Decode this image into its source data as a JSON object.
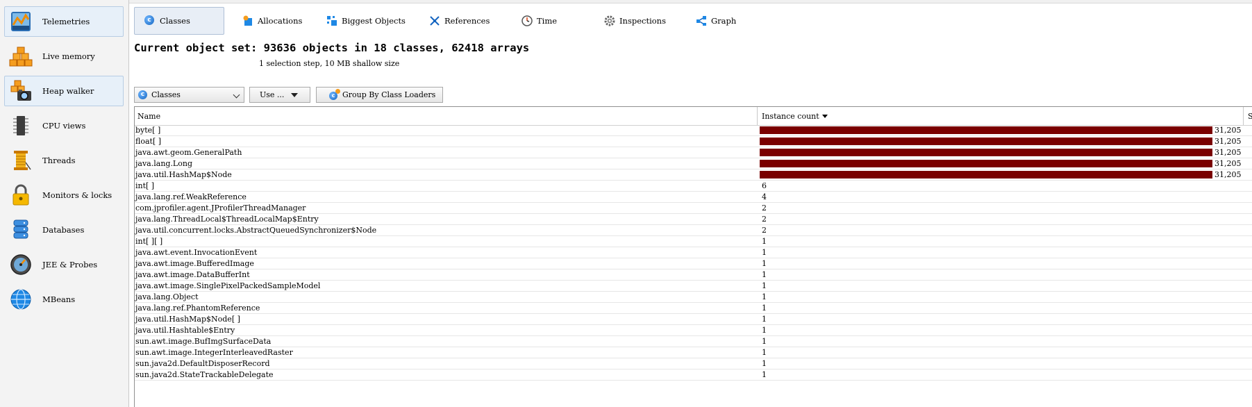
{
  "sidebar": {
    "items": [
      {
        "label": "Telemetries",
        "icon": "telemetries-icon",
        "selected": true
      },
      {
        "label": "Live memory",
        "icon": "live-memory-icon",
        "selected": false
      },
      {
        "label": "Heap walker",
        "icon": "heap-walker-icon",
        "selected": true
      },
      {
        "label": "CPU views",
        "icon": "cpu-views-icon",
        "selected": false
      },
      {
        "label": "Threads",
        "icon": "threads-icon",
        "selected": false
      },
      {
        "label": "Monitors & locks",
        "icon": "lock-icon",
        "selected": false
      },
      {
        "label": "Databases",
        "icon": "database-icon",
        "selected": false
      },
      {
        "label": "JEE & Probes",
        "icon": "gauge-icon",
        "selected": false
      },
      {
        "label": "MBeans",
        "icon": "globe-icon",
        "selected": false
      }
    ]
  },
  "tabs": [
    {
      "label": "Classes",
      "icon": "class-icon",
      "selected": true
    },
    {
      "label": "Allocations",
      "icon": "allocations-icon",
      "selected": false
    },
    {
      "label": "Biggest Objects",
      "icon": "biggest-objects-icon",
      "selected": false
    },
    {
      "label": "References",
      "icon": "references-icon",
      "selected": false
    },
    {
      "label": "Time",
      "icon": "clock-icon",
      "selected": false
    },
    {
      "label": "Inspections",
      "icon": "gear-icon",
      "selected": false
    },
    {
      "label": "Graph",
      "icon": "graph-icon",
      "selected": false
    }
  ],
  "header": {
    "title": "Current object set: 93636 objects in 18 classes, 62418 arrays",
    "subtitle": "1 selection step, 10 MB shallow size"
  },
  "toolbar": {
    "view_select": "Classes",
    "use_label": "Use ...",
    "group_button": "Group By Class Loaders"
  },
  "table": {
    "columns": [
      "Name",
      "Instance count",
      "S"
    ],
    "sort_column": "Instance count",
    "sort_direction": "descending",
    "bar_color": "#7a0000",
    "rows": [
      {
        "name": "byte[ ]",
        "count": "31,205",
        "bar": 1.0
      },
      {
        "name": "float[ ]",
        "count": "31,205",
        "bar": 1.0
      },
      {
        "name": "java.awt.geom.GeneralPath",
        "count": "31,205",
        "bar": 1.0
      },
      {
        "name": "java.lang.Long",
        "count": "31,205",
        "bar": 1.0
      },
      {
        "name": "java.util.HashMap$Node",
        "count": "31,205",
        "bar": 1.0
      },
      {
        "name": "int[ ]",
        "count": "6",
        "bar": 0
      },
      {
        "name": "java.lang.ref.WeakReference",
        "count": "4",
        "bar": 0
      },
      {
        "name": "com.jprofiler.agent.JProfilerThreadManager",
        "count": "2",
        "bar": 0
      },
      {
        "name": "java.lang.ThreadLocal$ThreadLocalMap$Entry",
        "count": "2",
        "bar": 0
      },
      {
        "name": "java.util.concurrent.locks.AbstractQueuedSynchronizer$Node",
        "count": "2",
        "bar": 0
      },
      {
        "name": "int[ ][ ]",
        "count": "1",
        "bar": 0
      },
      {
        "name": "java.awt.event.InvocationEvent",
        "count": "1",
        "bar": 0
      },
      {
        "name": "java.awt.image.BufferedImage",
        "count": "1",
        "bar": 0
      },
      {
        "name": "java.awt.image.DataBufferInt",
        "count": "1",
        "bar": 0
      },
      {
        "name": "java.awt.image.SinglePixelPackedSampleModel",
        "count": "1",
        "bar": 0
      },
      {
        "name": "java.lang.Object",
        "count": "1",
        "bar": 0
      },
      {
        "name": "java.lang.ref.PhantomReference",
        "count": "1",
        "bar": 0
      },
      {
        "name": "java.util.HashMap$Node[ ]",
        "count": "1",
        "bar": 0
      },
      {
        "name": "java.util.Hashtable$Entry",
        "count": "1",
        "bar": 0
      },
      {
        "name": "sun.awt.image.BufImgSurfaceData",
        "count": "1",
        "bar": 0
      },
      {
        "name": "sun.awt.image.IntegerInterleavedRaster",
        "count": "1",
        "bar": 0
      },
      {
        "name": "sun.java2d.DefaultDisposerRecord",
        "count": "1",
        "bar": 0
      },
      {
        "name": "sun.java2d.StateTrackableDelegate",
        "count": "1",
        "bar": 0
      }
    ]
  }
}
